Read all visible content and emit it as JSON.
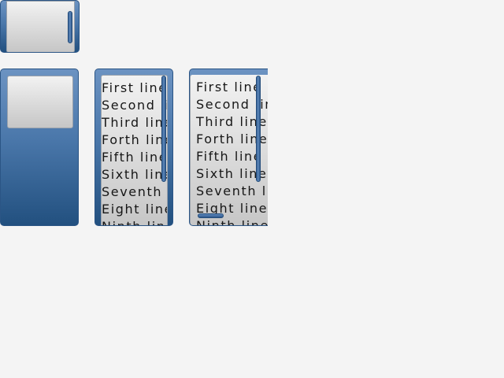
{
  "list_a": {
    "lines": [
      "First line",
      "Second line",
      "Third line",
      "Forth line",
      "Fifth line",
      "Sixth line",
      "Seventh line",
      "Eight line",
      "Ninth line"
    ]
  },
  "list_b": {
    "lines": [
      "First line",
      "Second line",
      "Third line",
      "Forth line",
      "Fifth line",
      "Sixth line",
      "Seventh line",
      "Eight line",
      "Ninth line"
    ]
  }
}
